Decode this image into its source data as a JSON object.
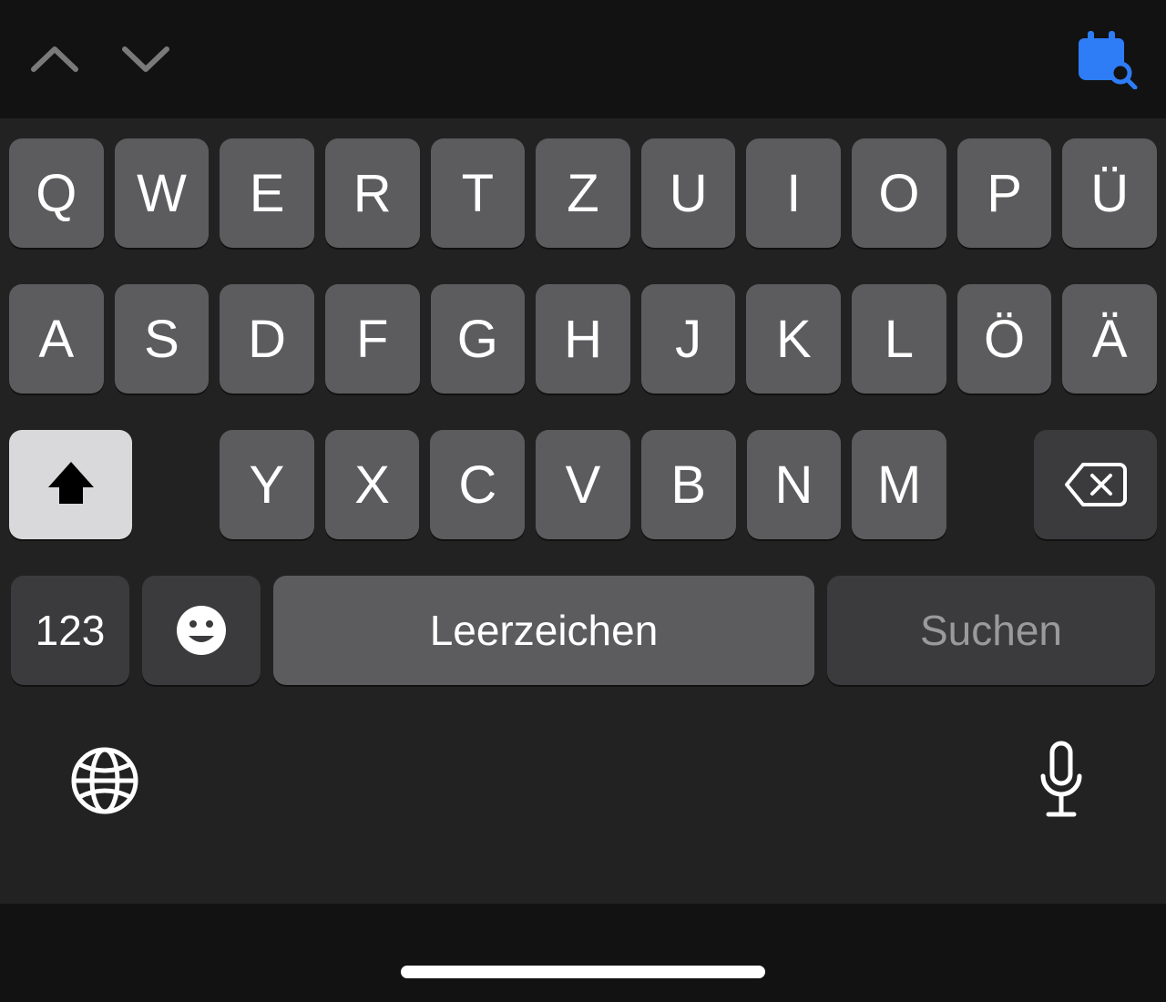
{
  "toolbar": {
    "prev_icon": "chevron-up",
    "next_icon": "chevron-down",
    "right_icon": "calendar-search"
  },
  "keyboard": {
    "row1": [
      "Q",
      "W",
      "E",
      "R",
      "T",
      "Z",
      "U",
      "I",
      "O",
      "P",
      "Ü"
    ],
    "row2": [
      "A",
      "S",
      "D",
      "F",
      "G",
      "H",
      "J",
      "K",
      "L",
      "Ö",
      "Ä"
    ],
    "row3": [
      "Y",
      "X",
      "C",
      "V",
      "B",
      "N",
      "M"
    ],
    "shift_icon": "shift-arrow",
    "backspace_icon": "backspace",
    "numbers_label": "123",
    "emoji_icon": "emoji",
    "space_label": "Leerzeichen",
    "action_label": "Suchen"
  },
  "system_row": {
    "left_icon": "globe",
    "right_icon": "microphone",
    "home_indicator": true
  }
}
